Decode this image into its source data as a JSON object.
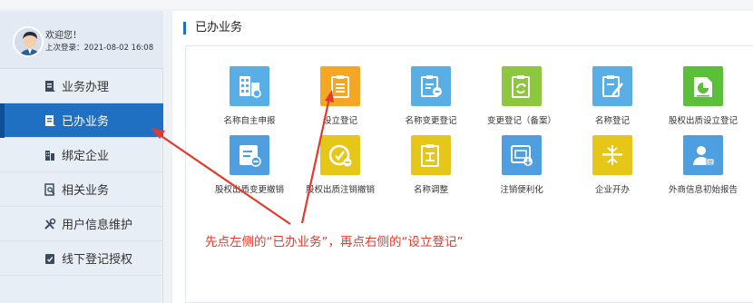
{
  "user": {
    "welcome": "欢迎您！",
    "last_login": "上次登录：2021-08-02 16:08"
  },
  "sidebar": {
    "items": [
      {
        "label": "业务办理",
        "icon": "business-handle-icon",
        "active": false
      },
      {
        "label": "已办业务",
        "icon": "done-business-icon",
        "active": true
      },
      {
        "label": "绑定企业",
        "icon": "bind-company-icon",
        "active": false
      },
      {
        "label": "相关业务",
        "icon": "related-business-icon",
        "active": false
      },
      {
        "label": "用户信息维护",
        "icon": "tools-icon",
        "active": false
      },
      {
        "label": "线下登记授权",
        "icon": "authorize-icon",
        "active": false
      }
    ]
  },
  "main": {
    "title": "已办业务",
    "tiles": [
      {
        "label": "名称自主申报",
        "color": "#5aaee6",
        "icon": "building-icon"
      },
      {
        "label": "设立登记",
        "color": "#f5a623",
        "icon": "clipboard-icon"
      },
      {
        "label": "名称变更登记",
        "color": "#5aaee6",
        "icon": "name-change-icon"
      },
      {
        "label": "变更登记（备案）",
        "color": "#8dc63f",
        "icon": "change-register-icon"
      },
      {
        "label": "名称登记",
        "color": "#5aaee6",
        "icon": "name-register-icon"
      },
      {
        "label": "股权出质设立登记",
        "color": "#5cbf3a",
        "icon": "equity-pledge-icon"
      },
      {
        "label": "股权出质变更撤销",
        "color": "#4f9fe0",
        "icon": "equity-change-icon"
      },
      {
        "label": "股权出质注销撤销",
        "color": "#e6c619",
        "icon": "cancel-icon"
      },
      {
        "label": "名称调整",
        "color": "#e6c619",
        "icon": "name-adjust-icon"
      },
      {
        "label": "注销便利化",
        "color": "#4f9fe0",
        "icon": "deregister-icon"
      },
      {
        "label": "企业开办",
        "color": "#e6c619",
        "icon": "enterprise-open-icon"
      },
      {
        "label": "外商信息初始报告",
        "color": "#4f9fe0",
        "icon": "foreign-report-icon"
      }
    ]
  },
  "annotation": {
    "text": "先点左侧的“已办业务”，再点右侧的“设立登记”",
    "color": "#e23b2e"
  }
}
